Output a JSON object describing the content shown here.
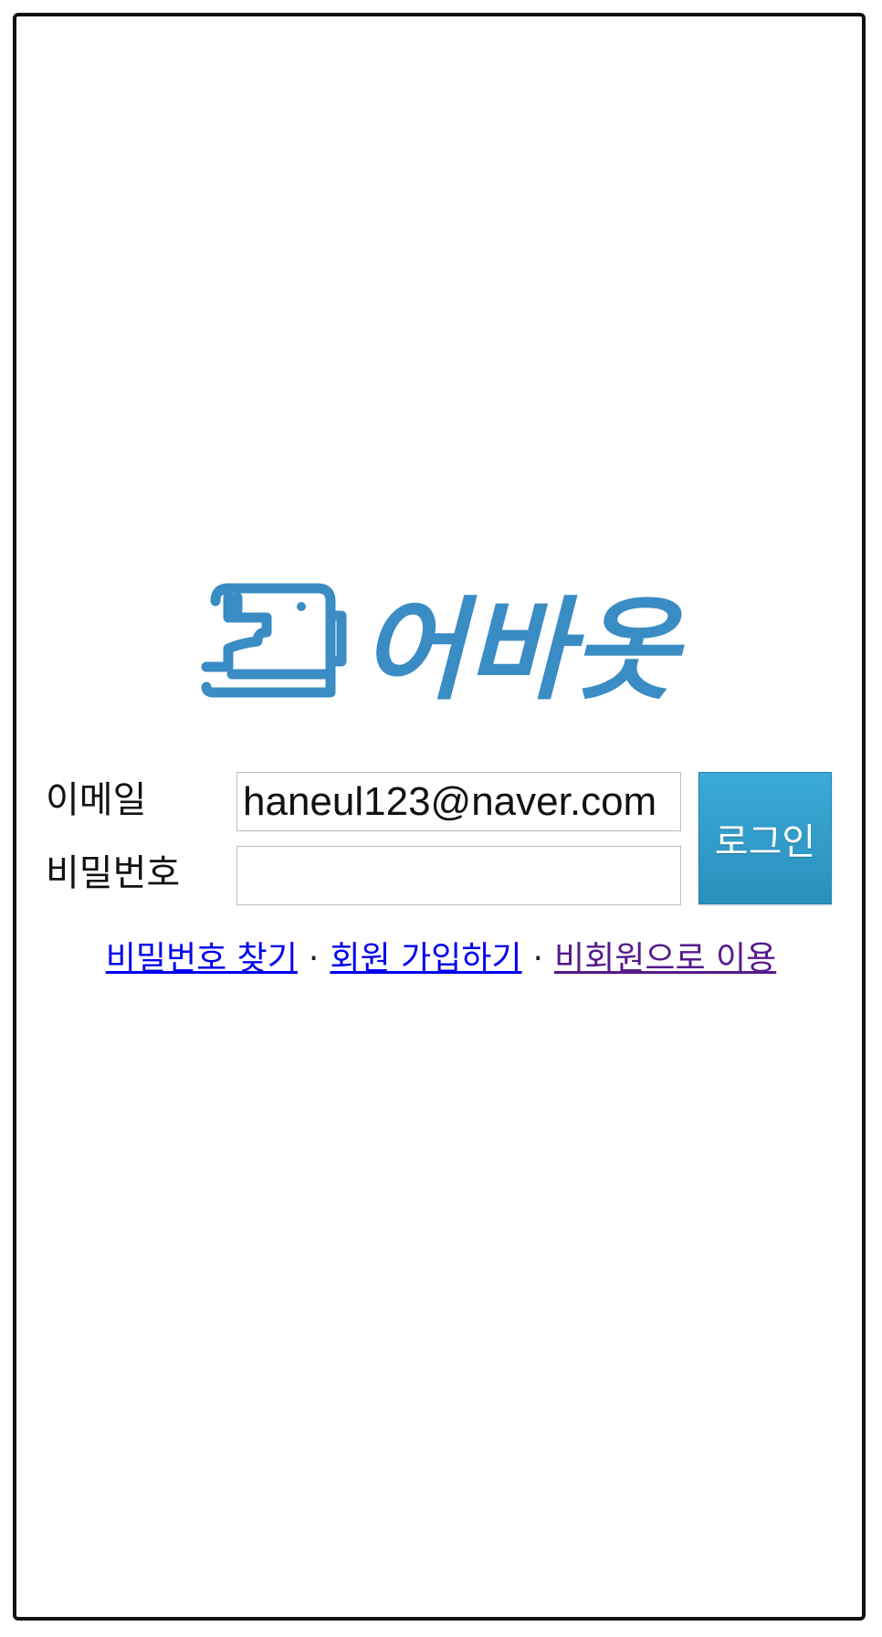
{
  "logo": {
    "text": "어바옷",
    "icon": "sewing-machine-icon",
    "color": "#3a8cc4"
  },
  "form": {
    "email_label": "이메일",
    "email_value": "haneul123@naver.com",
    "password_label": "비밀번호",
    "password_value": "",
    "login_button": "로그인",
    "login_button_color": "#3aa4d4"
  },
  "links": {
    "find_password": "비밀번호 찾기",
    "sign_up": "회원 가입하기",
    "guest": "비회원으로 이용",
    "separator": "·"
  }
}
